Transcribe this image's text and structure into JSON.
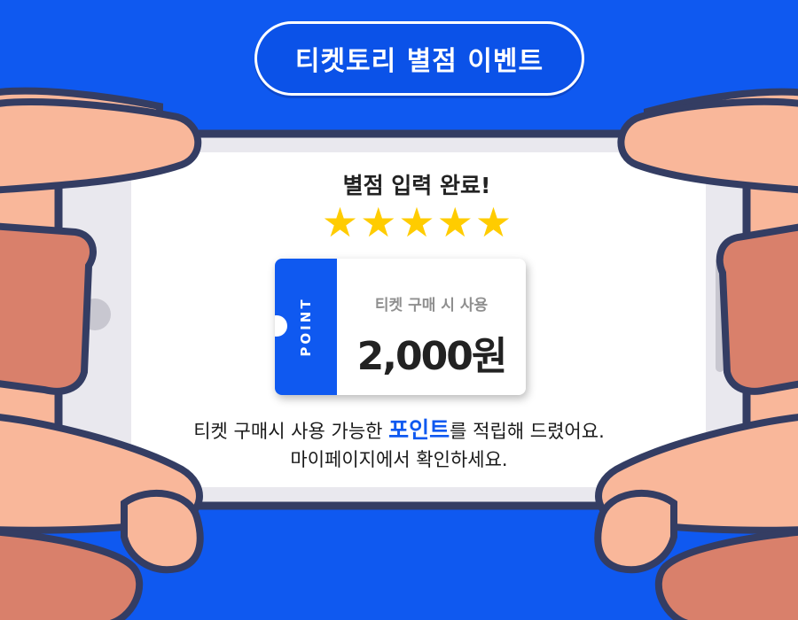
{
  "event_title": "티켓토리 별점 이벤트",
  "heading": "별점 입력 완료!",
  "rating": {
    "stars": 5,
    "max": 5
  },
  "coupon": {
    "stub_label": "POINT",
    "caption": "티켓 구매 시 사용",
    "amount": "2,000원"
  },
  "message": {
    "line1_before": "티켓 구매시 사용 가능한 ",
    "line1_highlight": "포인트",
    "line1_after": "를 적립해 드렸어요.",
    "line2": "마이페이지에서 확인하세요."
  },
  "colors": {
    "background": "#0f59f0",
    "accent": "#0f59f0",
    "star": "#ffcc00",
    "skin": "#f9b79a",
    "outline": "#343d63",
    "phone_body": "#e9e8ee"
  }
}
